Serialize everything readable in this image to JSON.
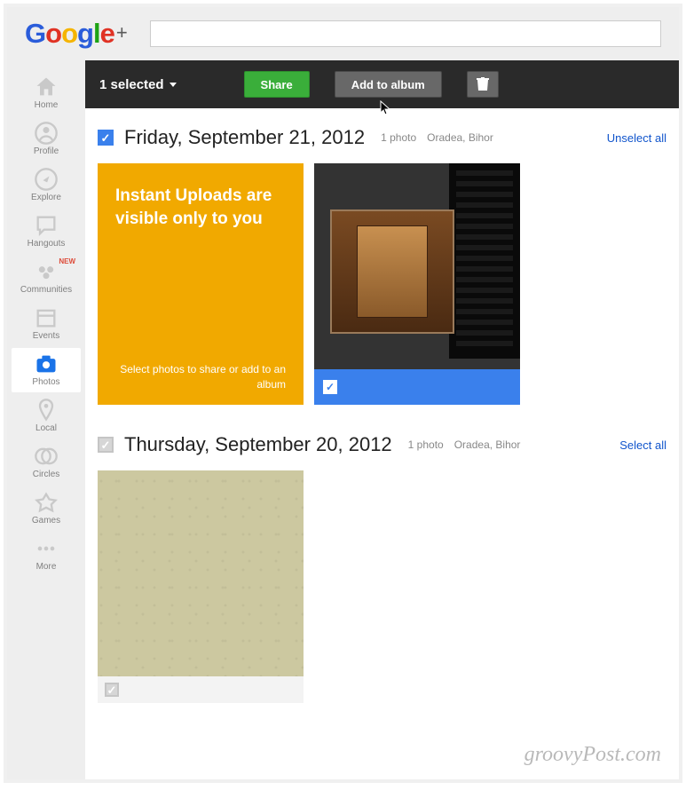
{
  "logo_plus": "+",
  "sidebar": [
    {
      "key": "home",
      "label": "Home"
    },
    {
      "key": "profile",
      "label": "Profile"
    },
    {
      "key": "explore",
      "label": "Explore"
    },
    {
      "key": "hangouts",
      "label": "Hangouts"
    },
    {
      "key": "communities",
      "label": "Communities",
      "badge": "NEW"
    },
    {
      "key": "events",
      "label": "Events"
    },
    {
      "key": "photos",
      "label": "Photos",
      "active": true
    },
    {
      "key": "local",
      "label": "Local"
    },
    {
      "key": "circles",
      "label": "Circles"
    },
    {
      "key": "games",
      "label": "Games"
    },
    {
      "key": "more",
      "label": "More"
    }
  ],
  "toolbar": {
    "selected_label": "1 selected",
    "share_label": "Share",
    "album_label": "Add to album"
  },
  "instant_card": {
    "title": "Instant Uploads are visible only to you",
    "sub": "Select photos to share or add to an album"
  },
  "days": [
    {
      "checked": true,
      "title": "Friday, September 21, 2012",
      "count": "1 photo",
      "location": "Oradea, Bihor",
      "action": "Unselect all"
    },
    {
      "checked": false,
      "title": "Thursday, September 20, 2012",
      "count": "1 photo",
      "location": "Oradea, Bihor",
      "action": "Select all"
    }
  ],
  "watermark": "groovyPost.com"
}
